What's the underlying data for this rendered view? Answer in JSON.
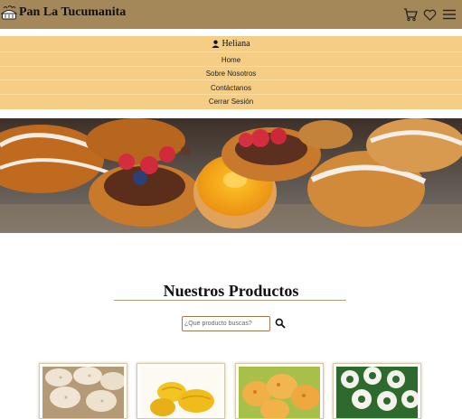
{
  "header": {
    "brand": "Pan La Tucumanita",
    "icons": [
      "cart-icon",
      "heart-icon",
      "hamburger-menu-icon"
    ],
    "color": "#a4885a"
  },
  "menu": {
    "user_name": "Heliana",
    "items": [
      {
        "label": "Home"
      },
      {
        "label": "Sobre Nosotros"
      },
      {
        "label": "Contáctanos"
      },
      {
        "label": "Cerrar Sesión"
      }
    ],
    "color": "#f5cd85"
  },
  "products": {
    "title": "Nuestros Productos",
    "search_placeholder": "¿Qué producto buscas?",
    "search_value": "",
    "cards": [
      {
        "image": "cookies-image"
      },
      {
        "image": "pastries-image"
      },
      {
        "image": "cheese-buns-image"
      },
      {
        "image": "rosquitas-image"
      }
    ]
  }
}
